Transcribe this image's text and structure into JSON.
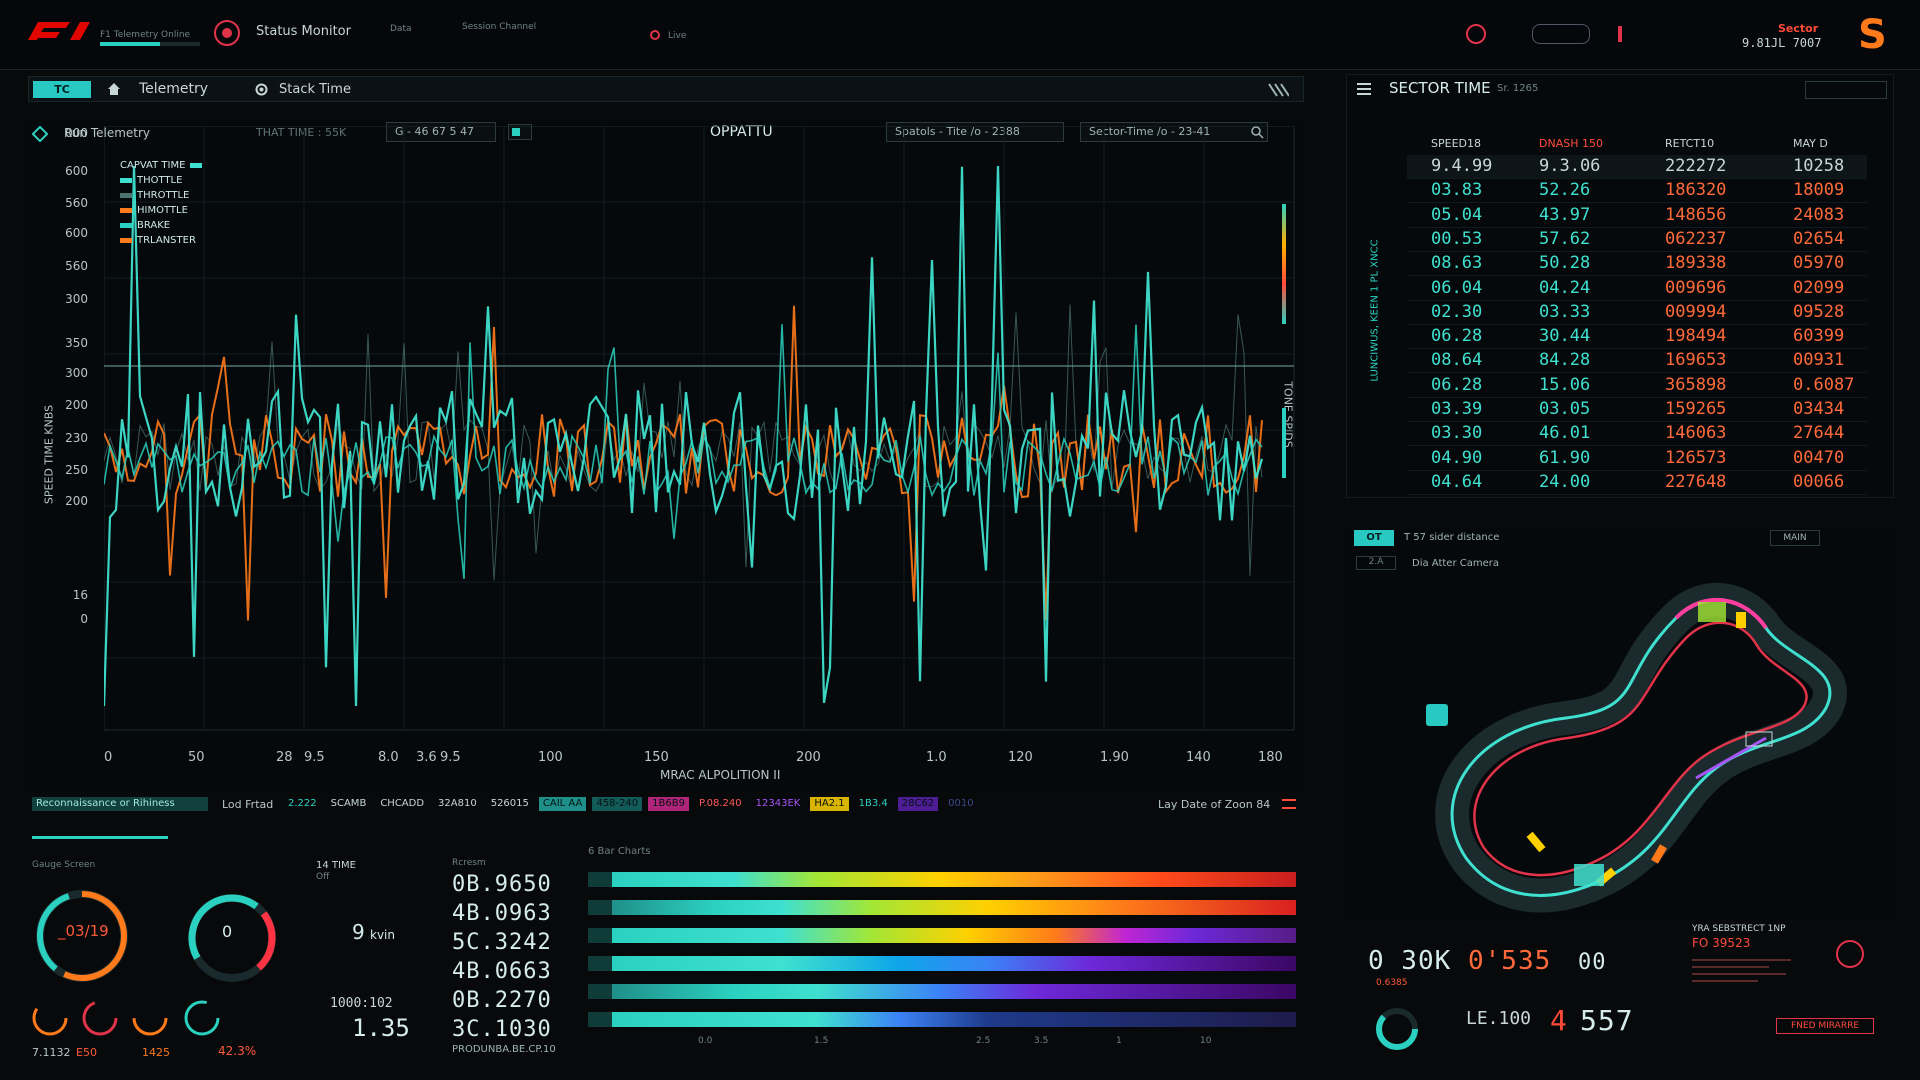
{
  "topbar": {
    "logo": "F1",
    "small_texts": [
      "F1 Telemetry Online",
      "Status Monitor",
      "Data",
      "Session Channel",
      "Live"
    ],
    "right_code_1": "Sector",
    "right_code_2": "9.81JL 7007",
    "brand_letter": "S"
  },
  "navbar": {
    "pill": "TC",
    "home_label": "Telemetry",
    "title": "Telemetry",
    "item": "Stack Time"
  },
  "chart_controls": {
    "session": "Run Telemetry",
    "time_label": "THAT TIME : 55K",
    "filter_1": "G - 46 67 5 47",
    "center_title": "OPPATTU",
    "box_1": "Spatols - Tite /o - 2388",
    "box_2": "Sector-Time /o - 23-41"
  },
  "chart_data": {
    "type": "line",
    "ylabel": "SPEED TIME KNBS",
    "xlabel": "MRAC ALPOLITION II",
    "right_label": "TONE SPIDS",
    "y_tick_labels": [
      "000",
      "600",
      "560",
      "600",
      "560",
      "300",
      "350",
      "300",
      "200",
      "230",
      "250",
      "200",
      "16",
      "0"
    ],
    "x_tick_labels": [
      "0",
      "50",
      "28",
      "9.5",
      "8.0",
      "3.6",
      "9.5",
      "100",
      "150",
      "200",
      "1.0",
      "120",
      "1.90",
      "140",
      "180"
    ],
    "legend": [
      "CAPVAT TIME",
      "THOTTLE",
      "THROTTLE",
      "HIMOTTLE",
      "BRAKE",
      "TRLANSTER"
    ],
    "grid": true,
    "series_colors": [
      "#3fe0cf",
      "#ff7a1a",
      "#6aa6a0",
      "#2bd1c0"
    ]
  },
  "status_strip": {
    "left": "Reconnaissance or Rihiness",
    "field": "Lod Frtad",
    "chips": [
      "2.222",
      "SCAMB",
      "CHCADD",
      "32A810",
      "526015",
      "CAIL AA",
      "458-240",
      "1B6B9",
      "P.08.240",
      "12343EK",
      "HA2.1",
      "1B3.4",
      "28C62",
      "0010"
    ],
    "right": "Lay Date of Zoon 84"
  },
  "gauges": {
    "title": "Gauge Screen",
    "g1_value": "_03/19",
    "g2_value": "0",
    "small_1": "7.1132",
    "small_2": "E50",
    "small_3": "1425",
    "pct": "42.3%"
  },
  "lap_time": {
    "title": "14 TIME",
    "sub": "Off",
    "speed": "9",
    "speed_unit": "kvin",
    "timer": "1000:102",
    "big": "1.35"
  },
  "readouts": {
    "title": "Rcresm",
    "values": [
      "0B.9650",
      "4B.0963",
      "5C.3242",
      "4B.0663",
      "0B.2270",
      "3C.1030"
    ],
    "footer": "PRODUNBA.BE.CP.10"
  },
  "bars": {
    "title": "6 Bar Charts",
    "axis": [
      "0.0",
      "1.5",
      "2.5",
      "3.5",
      "1",
      "10"
    ]
  },
  "sector_time": {
    "title": "SECTOR TIME",
    "subtitle": "Sr. 1265",
    "side_label": "LUNCIWUS, KEEN 1 PL XNCC",
    "columns": [
      "SPEED18",
      "DNASH 150",
      "RETCT10",
      "MAY D"
    ],
    "rows": [
      [
        "9.4.99",
        "9.3.06",
        "222272",
        "10258"
      ],
      [
        "03.83",
        "52.26",
        "186320",
        "18009"
      ],
      [
        "05.04",
        "43.97",
        "148656",
        "24083"
      ],
      [
        "00.53",
        "57.62",
        "062237",
        "02654"
      ],
      [
        "08.63",
        "50.28",
        "189338",
        "05970"
      ],
      [
        "06.04",
        "04.24",
        "009696",
        "02099"
      ],
      [
        "02.30",
        "03.33",
        "009994",
        "09528"
      ],
      [
        "06.28",
        "30.44",
        "198494",
        "60399"
      ],
      [
        "08.64",
        "84.28",
        "169653",
        "00931"
      ],
      [
        "06.28",
        "15.06",
        "365898",
        "0.6087"
      ],
      [
        "03.39",
        "03.05",
        "159265",
        "03434"
      ],
      [
        "03.30",
        "46.01",
        "146063",
        "27644"
      ],
      [
        "04.90",
        "61.90",
        "126573",
        "00470"
      ],
      [
        "04.64",
        "24.00",
        "227648",
        "00066"
      ]
    ]
  },
  "map": {
    "tab": "OT",
    "title": "T 57 sider distance",
    "button": "MAIN",
    "sub_a": "2.A",
    "sub_b": "Dia Atter Camera"
  },
  "bottom_right": {
    "v1": "0 30K",
    "v1_sub": "0.6385",
    "v2": "0'535",
    "v3": "00",
    "v4": "4",
    "v5": "557",
    "v6": "LE.100",
    "sector_title": "YRA SEBSTRECT 1NP",
    "sector_code": "FO 39523",
    "button": "FNED MIRARRE"
  }
}
